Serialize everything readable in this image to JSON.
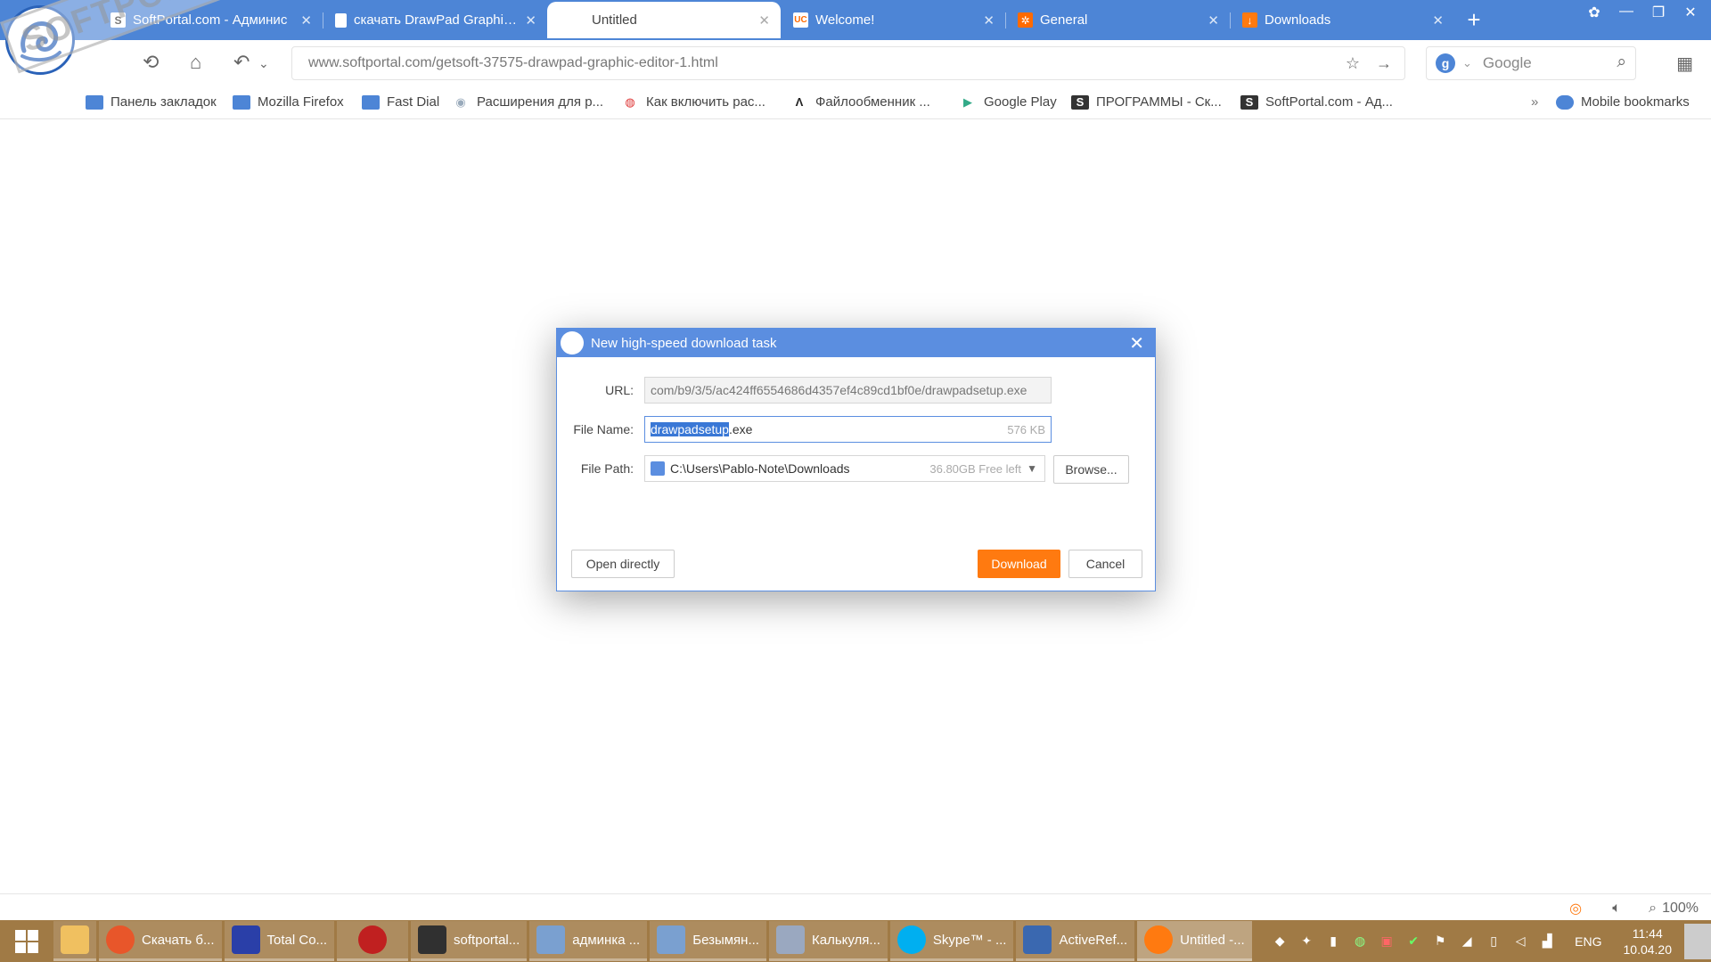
{
  "browser": {
    "tabs": [
      {
        "label": "SoftPortal.com - Админис",
        "favicon": "S",
        "favicon_color": "#333333",
        "active": false
      },
      {
        "label": "скачать DrawPad Graphic E",
        "favicon": "doc",
        "favicon_color": "#ffffff",
        "active": false
      },
      {
        "label": "Untitled",
        "favicon": "",
        "favicon_color": "",
        "active": true
      },
      {
        "label": "Welcome!",
        "favicon": "UC",
        "favicon_color": "#ff6a00",
        "active": false
      },
      {
        "label": "General",
        "favicon": "gear",
        "favicon_color": "#ff6a00",
        "active": false
      },
      {
        "label": "Downloads",
        "favicon": "down",
        "favicon_color": "#ff7a10",
        "active": false
      }
    ],
    "address": "www.softportal.com/getsoft-37575-drawpad-graphic-editor-1.html",
    "search_engine": "Google",
    "bookmarks": [
      {
        "label": "Панель закладок",
        "icon": "folder-icon"
      },
      {
        "label": "Mozilla Firefox",
        "icon": "folder-icon"
      },
      {
        "label": "Fast Dial",
        "icon": "folder-icon"
      },
      {
        "label": "Расширения для р...",
        "icon": "globe-icon"
      },
      {
        "label": "Как включить рас...",
        "icon": "chrome-icon"
      },
      {
        "label": "Файлообменник ...",
        "icon": "lambda-icon"
      },
      {
        "label": "Google Play",
        "icon": "play-icon"
      },
      {
        "label": "ПРОГРАММЫ - Ск...",
        "icon": "s-icon"
      },
      {
        "label": "SoftPortal.com - Ад...",
        "icon": "s-icon"
      }
    ],
    "mobile_bookmarks": "Mobile bookmarks",
    "watermark": "SOFTPORTAL"
  },
  "dialog": {
    "title": "New high-speed download task",
    "url_label": "URL:",
    "url_value": "com/b9/3/5/ac424ff6554686d4357ef4c89cd1bf0e/drawpadsetup.exe",
    "filename_label": "File Name:",
    "filename_selected": "drawpadsetup",
    "filename_ext": ".exe",
    "filesize": "576 KB",
    "filepath_label": "File Path:",
    "filepath_value": "C:\\Users\\Pablo-Note\\Downloads",
    "free_space": "36.80GB Free left",
    "browse_label": "Browse...",
    "open_directly_label": "Open directly",
    "download_label": "Download",
    "cancel_label": "Cancel"
  },
  "statusbar": {
    "zoom": "100%"
  },
  "taskbar": {
    "items": [
      {
        "label": "",
        "icon": "explorer-icon",
        "color": "#f0c060"
      },
      {
        "label": "Скачать б...",
        "icon": "firefox-icon",
        "color": "#e8562a"
      },
      {
        "label": "Total Co...",
        "icon": "floppy-icon",
        "color": "#2a3fa8"
      },
      {
        "label": "",
        "icon": "bug-icon",
        "color": "#c02020"
      },
      {
        "label": "softportal...",
        "icon": "terminal-icon",
        "color": "#303030"
      },
      {
        "label": "админка ...",
        "icon": "notepad-icon",
        "color": "#7aa0d0"
      },
      {
        "label": "Безымян...",
        "icon": "notepad-icon",
        "color": "#7aa0d0"
      },
      {
        "label": "Калькуля...",
        "icon": "calculator-icon",
        "color": "#9aa8c0"
      },
      {
        "label": "Skype™ - ...",
        "icon": "skype-icon",
        "color": "#00aff0"
      },
      {
        "label": "ActiveRef...",
        "icon": "doc-icon",
        "color": "#3a68b0"
      },
      {
        "label": "Untitled -...",
        "icon": "uc-icon",
        "color": "#ff7a10"
      }
    ],
    "language": "ENG",
    "time": "11:44",
    "date": "10.04.20"
  }
}
